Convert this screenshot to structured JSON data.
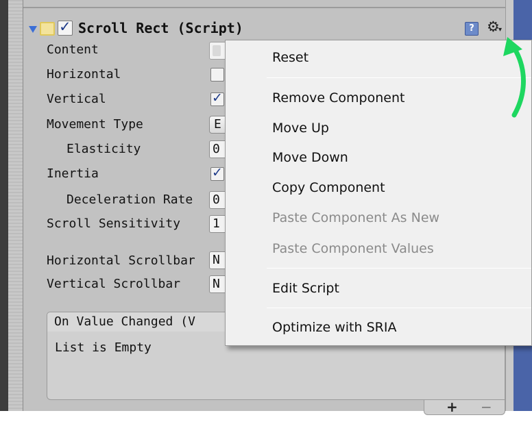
{
  "component": {
    "title": "Scroll Rect (Script)",
    "enabled": true
  },
  "properties": [
    {
      "label": "Content",
      "kind": "object",
      "value": ""
    },
    {
      "label": "Horizontal",
      "kind": "checkbox",
      "checked": false
    },
    {
      "label": "Vertical",
      "kind": "checkbox",
      "checked": true
    },
    {
      "label": "Movement Type",
      "kind": "dropdown",
      "value": "E"
    },
    {
      "label": "Elasticity",
      "kind": "number",
      "value": "0",
      "indent": true
    },
    {
      "label": "Inertia",
      "kind": "checkbox",
      "checked": true
    },
    {
      "label": "Deceleration Rate",
      "kind": "number",
      "value": "0",
      "indent": true
    },
    {
      "label": "Scroll Sensitivity",
      "kind": "number",
      "value": "1"
    },
    {
      "label": "Horizontal Scrollbar",
      "kind": "object-text",
      "value": "N"
    },
    {
      "label": "Vertical Scrollbar",
      "kind": "object-text",
      "value": "N"
    }
  ],
  "event": {
    "header": "On Value Changed (V",
    "empty_text": "List is Empty",
    "add_label": "+",
    "remove_label": "−"
  },
  "menu": {
    "items": [
      {
        "label": "Reset",
        "enabled": true
      },
      {
        "label": "Remove Component",
        "enabled": true
      },
      {
        "label": "Move Up",
        "enabled": true
      },
      {
        "label": "Move Down",
        "enabled": true
      },
      {
        "label": "Copy Component",
        "enabled": true
      },
      {
        "label": "Paste Component As New",
        "enabled": false
      },
      {
        "label": "Paste Component Values",
        "enabled": false
      },
      {
        "label": "Edit Script",
        "enabled": true
      },
      {
        "label": "Optimize with SRIA",
        "enabled": true
      }
    ]
  },
  "icons": {
    "foldout": "foldout-arrow-icon",
    "script": "script-icon",
    "help": "help-icon",
    "gear": "gear-icon",
    "annotation": "green-arrow-icon"
  },
  "colors": {
    "accent_blue": "#3b6ed6",
    "annotation_green": "#1ed760",
    "disabled_text": "#8a8a8a"
  }
}
